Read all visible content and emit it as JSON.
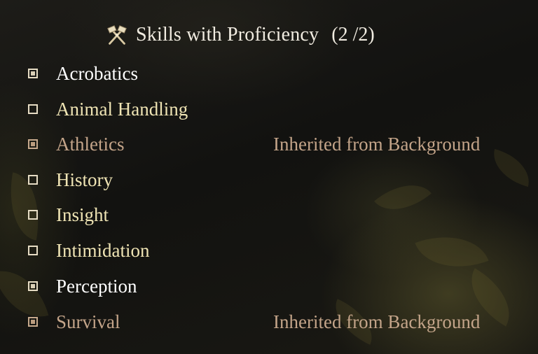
{
  "header": {
    "icon": "crossed-hammers-icon",
    "title": "Skills with Proficiency",
    "count": "(2 /2)"
  },
  "skills": [
    {
      "label": "Acrobatics",
      "state": "selected",
      "note": ""
    },
    {
      "label": "Animal Handling",
      "state": "available",
      "note": ""
    },
    {
      "label": "Athletics",
      "state": "inherited",
      "note": "Inherited from Background"
    },
    {
      "label": "History",
      "state": "available",
      "note": ""
    },
    {
      "label": "Insight",
      "state": "available",
      "note": ""
    },
    {
      "label": "Intimidation",
      "state": "available",
      "note": ""
    },
    {
      "label": "Perception",
      "state": "selected",
      "note": ""
    },
    {
      "label": "Survival",
      "state": "inherited",
      "note": "Inherited from Background"
    }
  ],
  "colors": {
    "selected_text": "#ffffff",
    "available_text": "#efe4b4",
    "inherited_text": "#c3a489",
    "title_text": "#f1ece1"
  }
}
